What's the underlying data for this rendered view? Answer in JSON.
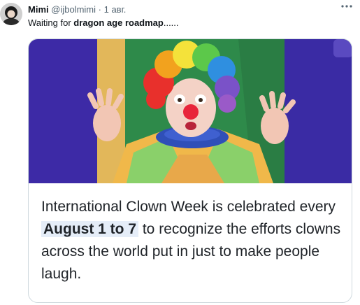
{
  "tweet": {
    "author_name": "Mimi",
    "author_handle": "@ijbolmimi",
    "dot": "·",
    "time": "1 авг.",
    "more_icon": "more-horizontal-icon",
    "text_prefix": "Waiting for ",
    "text_bold": "dragon age roadmap",
    "text_suffix": "......"
  },
  "media": {
    "photo_icon": "clown-photo",
    "caption_before": "International Clown Week is celebrated every ",
    "caption_highlight": "August 1 to 7",
    "caption_after": " to recognize the efforts clowns across the world put in just to make people laugh."
  },
  "colors": {
    "banner_left": "#3d2aa6",
    "banner_right": "#3d2aa6",
    "backdrop": "#2e8a4a",
    "highlight": "#e5edf8"
  }
}
